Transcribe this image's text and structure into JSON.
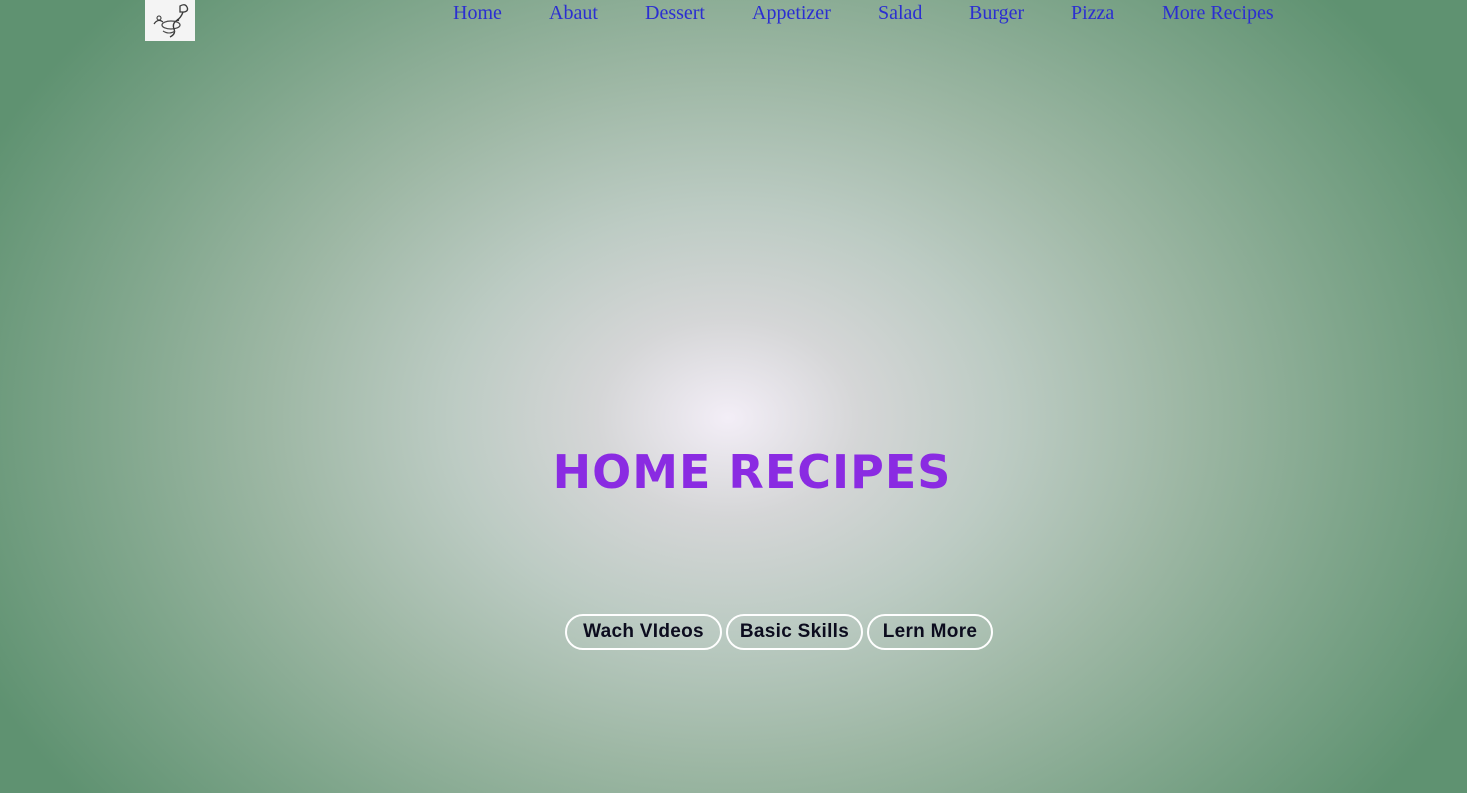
{
  "nav": {
    "items": [
      {
        "label": "Home"
      },
      {
        "label": "Abaut"
      },
      {
        "label": "Dessert"
      },
      {
        "label": "Appetizer"
      },
      {
        "label": "Salad"
      },
      {
        "label": "Burger"
      },
      {
        "label": "Pizza"
      },
      {
        "label": "More Recipes"
      }
    ],
    "link_color": "#2b2ed1"
  },
  "logo": {
    "icon": "chef-logo-icon"
  },
  "hero": {
    "title": "HOME RECIPES",
    "title_color": "#8a2be2",
    "buttons": [
      {
        "label": "Wach VIdeos"
      },
      {
        "label": "Basic Skills"
      },
      {
        "label": "Lern More"
      }
    ]
  },
  "colors": {
    "background_center": "#f3eef7",
    "background_edge": "#5f9271"
  }
}
